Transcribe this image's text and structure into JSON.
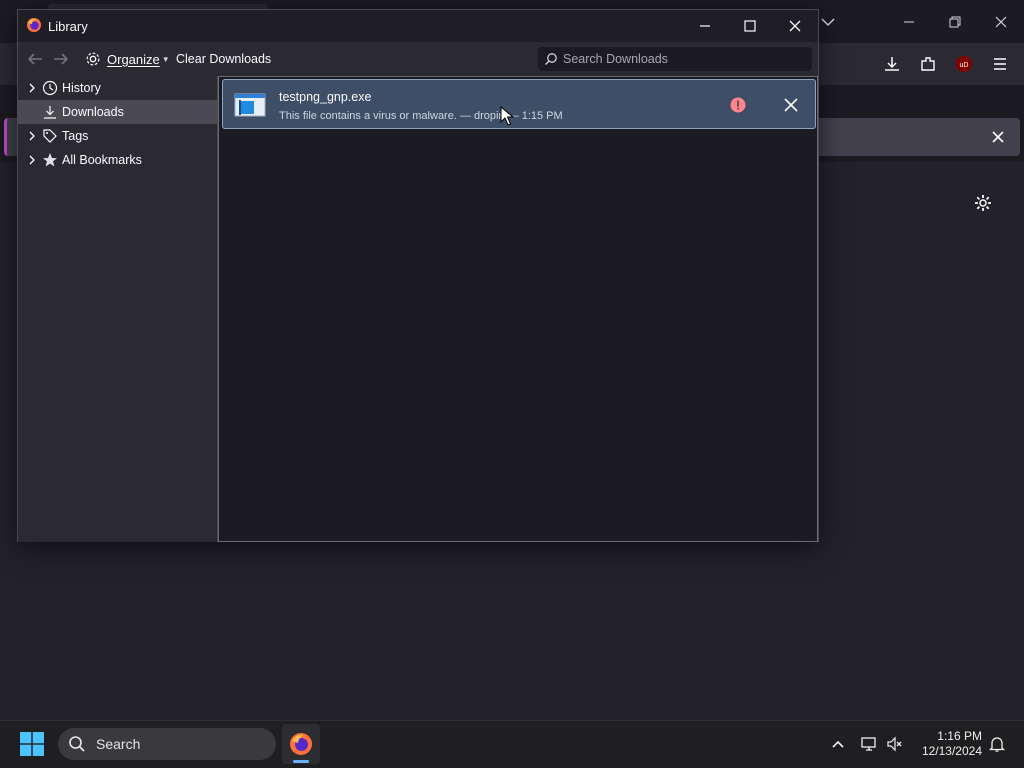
{
  "library": {
    "title": "Library",
    "toolbar": {
      "organize_label": "Organize",
      "clear_downloads_label": "Clear Downloads",
      "search_placeholder": "Search Downloads"
    },
    "sidebar": {
      "items": [
        {
          "label": "History",
          "icon": "clock-icon",
          "expandable": true,
          "selected": false
        },
        {
          "label": "Downloads",
          "icon": "download-icon",
          "expandable": false,
          "selected": true
        },
        {
          "label": "Tags",
          "icon": "tag-icon",
          "expandable": true,
          "selected": false
        },
        {
          "label": "All Bookmarks",
          "icon": "star-icon",
          "expandable": true,
          "selected": false
        }
      ]
    },
    "downloads": [
      {
        "filename": "testpng_gnp.exe",
        "status": "This file contains a virus or malware. — dropin — 1:15 PM",
        "warning_icon": "warning-icon",
        "warning_color": "#ff848b"
      }
    ]
  },
  "taskbar": {
    "search_label": "Search",
    "time": "1:16 PM",
    "date": "12/13/2024",
    "accent_color": "#6ab1ff"
  }
}
